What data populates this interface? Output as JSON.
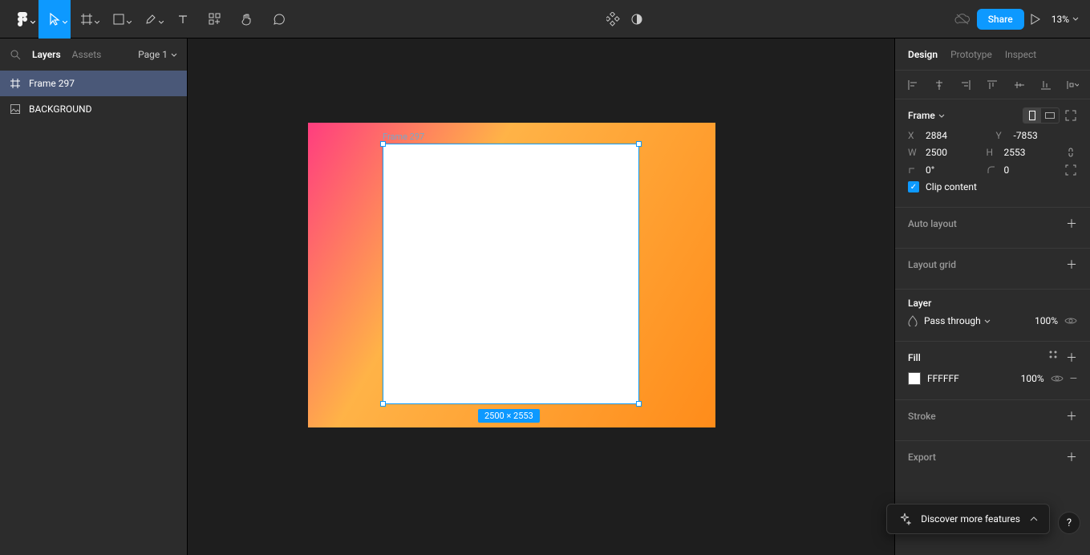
{
  "toolbar": {
    "share_label": "Share",
    "zoom": "13%"
  },
  "left": {
    "tab_layers": "Layers",
    "tab_assets": "Assets",
    "page_label": "Page 1",
    "layers": [
      {
        "name": "Frame 297"
      },
      {
        "name": "BACKGROUND"
      }
    ]
  },
  "canvas": {
    "selected_frame_label": "Frame 297",
    "dimensions_badge": "2500 × 2553"
  },
  "right": {
    "tab_design": "Design",
    "tab_prototype": "Prototype",
    "tab_inspect": "Inspect",
    "frame": {
      "title": "Frame",
      "x_label": "X",
      "x": "2884",
      "y_label": "Y",
      "y": "-7853",
      "w_label": "W",
      "w": "2500",
      "h_label": "H",
      "h": "2553",
      "rotation": "0°",
      "radius": "0",
      "clip_label": "Clip content"
    },
    "auto_layout": "Auto layout",
    "layout_grid": "Layout grid",
    "layer_section": "Layer",
    "layer_blend": "Pass through",
    "layer_opacity": "100%",
    "fill_section": "Fill",
    "fill_hex": "FFFFFF",
    "fill_opacity": "100%",
    "stroke_section": "Stroke",
    "export_section": "Export"
  },
  "discover": "Discover more features"
}
